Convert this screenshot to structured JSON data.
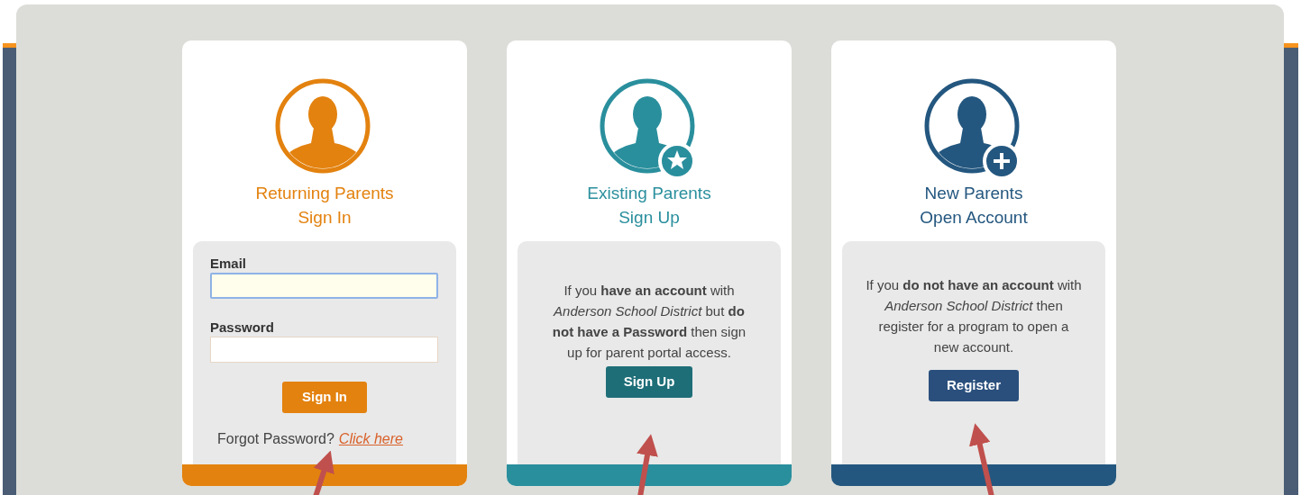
{
  "cards": [
    {
      "kind": "login",
      "color": "#e3820f",
      "title_lines": [
        "Returning Parents",
        "Sign In"
      ],
      "fields": [
        {
          "label": "Email",
          "focused": true
        },
        {
          "label": "Password",
          "focused": false
        }
      ],
      "button": "Sign In",
      "forgot_text": "Forgot Password?",
      "link": "Click here"
    },
    {
      "kind": "signup",
      "color": "#2a8f9d",
      "title_lines": [
        "Existing Parents",
        "Sign Up"
      ],
      "text": "If you **have an account** with *Anderson School District* but **do not have a Password** then sign up for parent portal access.",
      "button": "Sign Up"
    },
    {
      "kind": "register",
      "color": "#24577f",
      "title_lines": [
        "New Parents",
        "Open Account"
      ],
      "text": "If you **do not have an account** with *Anderson School District* then register for a program to open a new account.",
      "button": "Register"
    }
  ]
}
